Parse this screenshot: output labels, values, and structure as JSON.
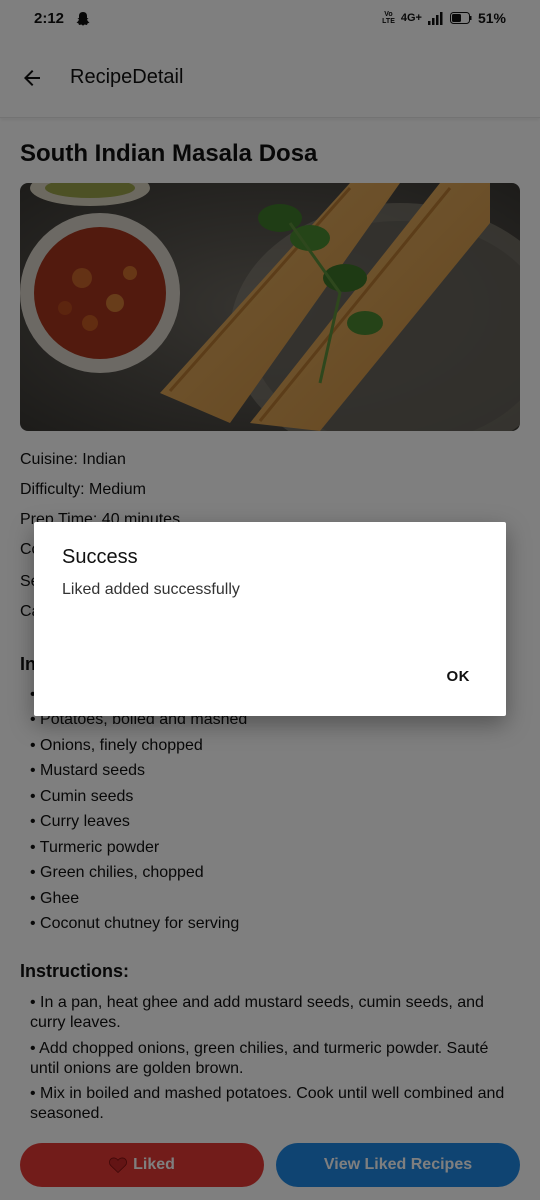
{
  "status_bar": {
    "time": "2:12",
    "volte": "Vo\nLTE",
    "network": "4G+",
    "battery": "51%"
  },
  "app_bar": {
    "title": "RecipeDetail"
  },
  "recipe": {
    "title": "South Indian Masala Dosa",
    "image_icon": "dosa-photo",
    "meta": [
      "Cuisine: Indian",
      "Difficulty: Medium",
      "Prep Time: 40 minutes",
      "Co",
      "Se",
      "Ca"
    ],
    "ingredients_heading": "In",
    "ingredients": [
      "•",
      "• Potatoes, boiled and mashed",
      "• Onions, finely chopped",
      "• Mustard seeds",
      "• Cumin seeds",
      "• Curry leaves",
      "• Turmeric powder",
      "• Green chilies, chopped",
      "• Ghee",
      "• Coconut chutney for serving"
    ],
    "instructions_heading": "Instructions:",
    "instructions": [
      "• In a pan, heat ghee and add mustard seeds, cumin seeds, and curry leaves.",
      "• Add chopped onions, green chilies, and turmeric powder. Sauté until onions are golden brown.",
      "• Mix in boiled and mashed potatoes. Cook until well combined and seasoned."
    ]
  },
  "buttons": {
    "liked_label": "Liked",
    "view_liked_label": "View Liked Recipes"
  },
  "dialog": {
    "title": "Success",
    "message": "Liked added successfully",
    "ok_label": "OK"
  },
  "colors": {
    "liked": "#e53935",
    "view_liked": "#1e88e5",
    "scrim": "rgba(0,0,0,0.5)"
  }
}
